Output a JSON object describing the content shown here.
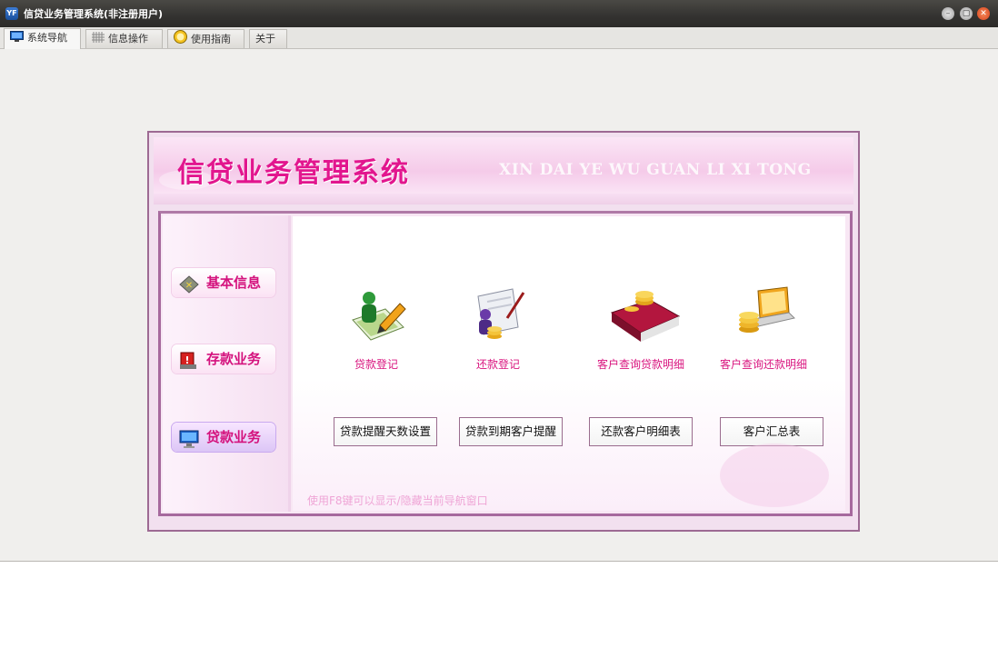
{
  "window": {
    "title": "信贷业务管理系统(非注册用户)",
    "app_icon_text": "YF"
  },
  "tabs": [
    {
      "label": "系统导航",
      "icon": "monitor-icon"
    },
    {
      "label": "信息操作",
      "icon": "grid-icon"
    },
    {
      "label": "使用指南",
      "icon": "guide-icon"
    },
    {
      "label": "关于",
      "icon": ""
    }
  ],
  "header": {
    "title": "信贷业务管理系统",
    "subtitle": "XIN DAI YE WU GUAN LI XI TONG"
  },
  "sidebar": {
    "items": [
      {
        "label": "基本信息",
        "icon": "diamond-icon"
      },
      {
        "label": "存款业务",
        "icon": "alert-icon"
      },
      {
        "label": "贷款业务",
        "icon": "computer-icon",
        "active": true
      }
    ]
  },
  "functions": [
    {
      "label": "贷款登记",
      "icon": "register-icon"
    },
    {
      "label": "还款登记",
      "icon": "repayment-icon"
    },
    {
      "label": "客户查询贷款明细",
      "icon": "loan-detail-icon"
    },
    {
      "label": "客户查询还款明细",
      "icon": "repay-detail-icon"
    }
  ],
  "actions": [
    {
      "label": "贷款提醒天数设置"
    },
    {
      "label": "贷款到期客户提醒"
    },
    {
      "label": "还款客户明细表"
    },
    {
      "label": "客户汇总表"
    }
  ],
  "hint": "使用F8键可以显示/隐藏当前导航窗口",
  "colors": {
    "accent": "#d4127d",
    "frame": "#a6699d",
    "header_bg": "#f5cbe9"
  }
}
